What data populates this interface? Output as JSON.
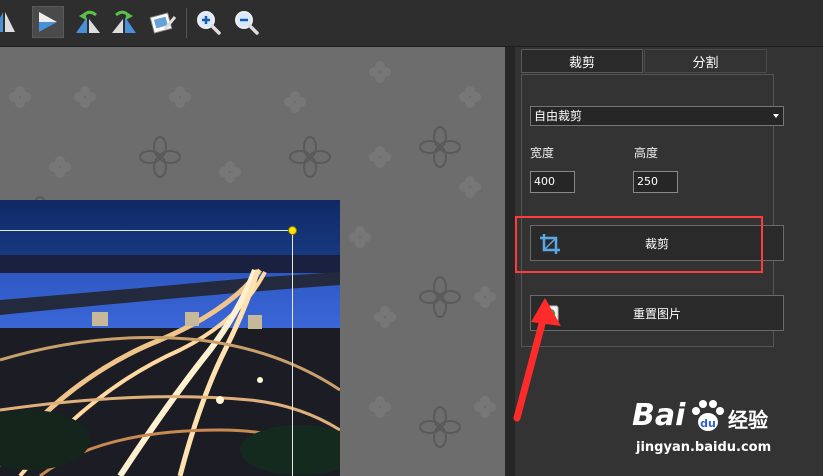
{
  "toolbar": {
    "buttons": [
      {
        "icon": "flip-horizontal-icon"
      },
      {
        "icon": "flip-horizontal-active-icon",
        "active": true
      },
      {
        "icon": "rotate-left-icon"
      },
      {
        "icon": "rotate-right-icon"
      },
      {
        "icon": "edit-image-icon"
      },
      {
        "icon": "zoom-in-icon"
      },
      {
        "icon": "zoom-out-icon"
      }
    ]
  },
  "panel": {
    "tabs": [
      {
        "label": "裁剪",
        "active": true
      },
      {
        "label": "分割",
        "active": false
      }
    ],
    "mode_select": {
      "value": "自由裁剪"
    },
    "width": {
      "label": "宽度",
      "value": "400"
    },
    "height": {
      "label": "高度",
      "value": "250"
    },
    "crop_button": {
      "label": "裁剪",
      "icon": "crop-icon"
    },
    "reset_button": {
      "label": "重置图片",
      "icon": "reset-image-icon"
    }
  },
  "watermark": {
    "brand": "Bai",
    "brand_suffix": "经验",
    "url": "jingyan.baidu.com"
  },
  "colors": {
    "highlight": "#ff3b3b",
    "crop_handle": "#ffe400",
    "panel_bg": "#333333",
    "canvas_bg": "#6d6d6d"
  }
}
